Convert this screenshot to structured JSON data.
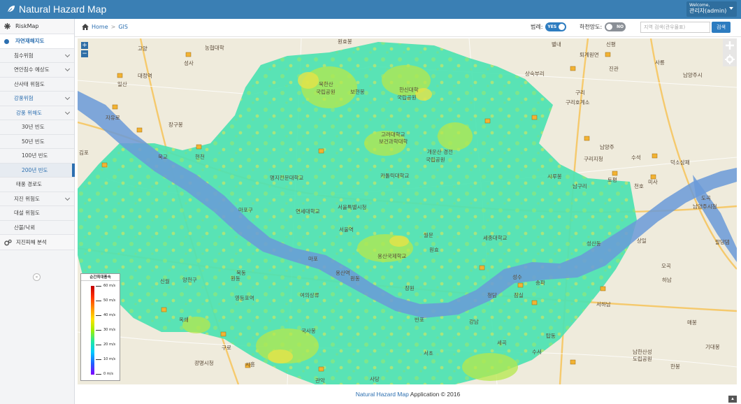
{
  "app": {
    "title": "Natural Hazard Map"
  },
  "user": {
    "welcome": "Welcome,",
    "name": "관리자(admin)"
  },
  "sidebar": {
    "top": "RiskMap",
    "items": [
      {
        "label": "자연재해지도"
      },
      {
        "label": "침수위험"
      },
      {
        "label": "연안침수 예상도"
      },
      {
        "label": "산사태 위험도"
      },
      {
        "label": "강풍위험"
      },
      {
        "label": "강풍 위해도"
      },
      {
        "label": "30년 빈도"
      },
      {
        "label": "50년 빈도"
      },
      {
        "label": "100년 빈도"
      },
      {
        "label": "200년 빈도"
      },
      {
        "label": "태풍 경로도"
      },
      {
        "label": "지진 위험도"
      },
      {
        "label": "대설 위험도"
      },
      {
        "label": "산불/낙뢰"
      }
    ],
    "analysis": "지진피해 분석",
    "collapse": "«"
  },
  "breadcrumb": {
    "home": "Home",
    "sep": ">",
    "current": "GIS"
  },
  "toolbar": {
    "legend_label": "범례:",
    "legend_toggle": "YES",
    "river_label": "하천망도:",
    "river_toggle": "NO",
    "search_placeholder": "지역 검색(관우물표)",
    "search_button": "검색"
  },
  "map": {
    "zoom_in": "+",
    "zoom_out": "−",
    "labels": [
      {
        "text": "고양"
      },
      {
        "text": "대정역"
      },
      {
        "text": "농협대학"
      },
      {
        "text": "원효봉"
      },
      {
        "text": "별내"
      },
      {
        "text": "신평"
      },
      {
        "text": "퇴계원면"
      },
      {
        "text": "진관"
      },
      {
        "text": "사릉"
      },
      {
        "text": "일산"
      },
      {
        "text": "성사"
      },
      {
        "text": "북한산"
      },
      {
        "text": "국립공원"
      },
      {
        "text": "보현봉"
      },
      {
        "text": "한신대학"
      },
      {
        "text": "국립공원"
      },
      {
        "text": "상숙부리"
      },
      {
        "text": "남양주시"
      },
      {
        "text": "자유로"
      },
      {
        "text": "구리호계소"
      },
      {
        "text": "구리"
      },
      {
        "text": "장구봉"
      },
      {
        "text": "고려대학교"
      },
      {
        "text": "보건과학대학"
      },
      {
        "text": "개운산 경전"
      },
      {
        "text": "국립공원"
      },
      {
        "text": "남양주"
      },
      {
        "text": "김포"
      },
      {
        "text": "북교"
      },
      {
        "text": "현천"
      },
      {
        "text": "명지전문대학교"
      },
      {
        "text": "카톨릭대학교"
      },
      {
        "text": "시루봉"
      },
      {
        "text": "구리지청"
      },
      {
        "text": "수석"
      },
      {
        "text": "덕소삼패"
      },
      {
        "text": "미사"
      },
      {
        "text": "남구리"
      },
      {
        "text": "토평"
      },
      {
        "text": "도곡"
      },
      {
        "text": "연세대학교"
      },
      {
        "text": "서울특별시청"
      },
      {
        "text": "서울역"
      },
      {
        "text": "세종대학교"
      },
      {
        "text": "성산동"
      },
      {
        "text": "상일"
      },
      {
        "text": "월문"
      },
      {
        "text": "마포"
      },
      {
        "text": "용산국제학교"
      },
      {
        "text": "원효"
      },
      {
        "text": "용산역"
      },
      {
        "text": "성수"
      },
      {
        "text": "잠실"
      },
      {
        "text": "청담"
      },
      {
        "text": "송파"
      },
      {
        "text": "하남"
      },
      {
        "text": "원동"
      },
      {
        "text": "영등포역"
      },
      {
        "text": "여의상류"
      },
      {
        "text": "장원"
      },
      {
        "text": "천호"
      },
      {
        "text": "서하남"
      },
      {
        "text": "옥쇄"
      },
      {
        "text": "국사봉"
      },
      {
        "text": "반포"
      },
      {
        "text": "탑동"
      },
      {
        "text": "세곡"
      },
      {
        "text": "매봉"
      },
      {
        "text": "시흥"
      },
      {
        "text": "서초"
      },
      {
        "text": "수서"
      },
      {
        "text": "광명시청"
      },
      {
        "text": "관악"
      },
      {
        "text": "사당"
      },
      {
        "text": "남한산성"
      },
      {
        "text": "도립공원"
      },
      {
        "text": "한봉"
      },
      {
        "text": "기대봉"
      },
      {
        "text": "신월"
      },
      {
        "text": "구로"
      },
      {
        "text": "목동"
      },
      {
        "text": "원동"
      },
      {
        "text": "강남"
      },
      {
        "text": "오곡"
      },
      {
        "text": "팔당댐"
      },
      {
        "text": "남양주시청"
      },
      {
        "text": "양천구"
      },
      {
        "text": "마포구"
      }
    ]
  },
  "legend": {
    "title": "순간최대풍속",
    "ticks": [
      "60 m/s",
      "50 m/s",
      "40 m/s",
      "30 m/s",
      "20 m/s",
      "10 m/s",
      "0 m/s"
    ]
  },
  "footer": {
    "brand": "Natural Hazard Map",
    "rest": " Application © 2016",
    "top": "▲"
  }
}
